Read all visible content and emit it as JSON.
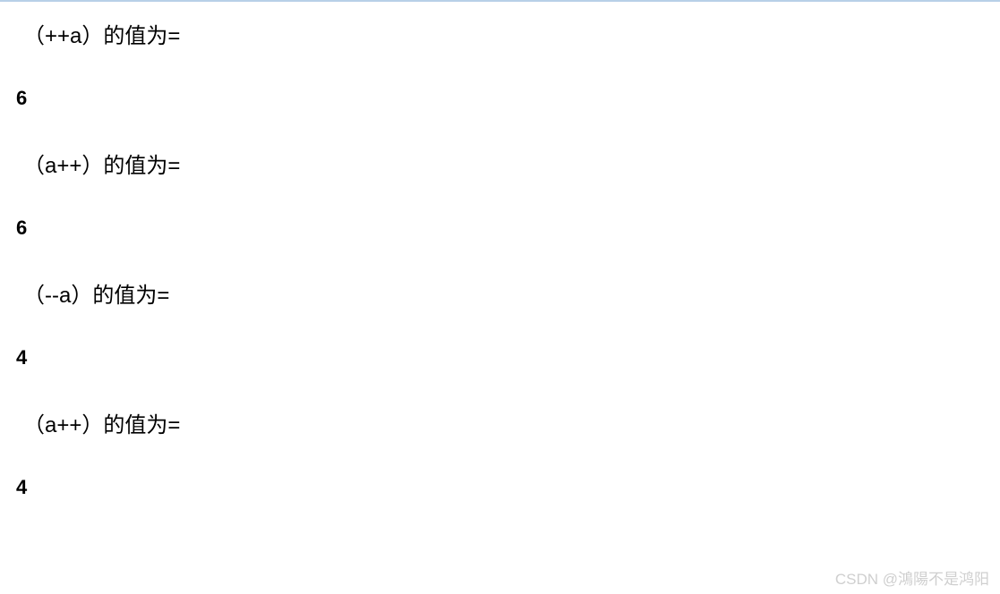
{
  "lines": [
    {
      "label": "（++a）的值为=",
      "result": "6"
    },
    {
      "label": "（a++）的值为=",
      "result": "6"
    },
    {
      "label": "（--a）的值为=",
      "result": "4"
    },
    {
      "label": "（a++）的值为=",
      "result": "4"
    }
  ],
  "watermark": "CSDN @鴻陽不是鸿阳"
}
